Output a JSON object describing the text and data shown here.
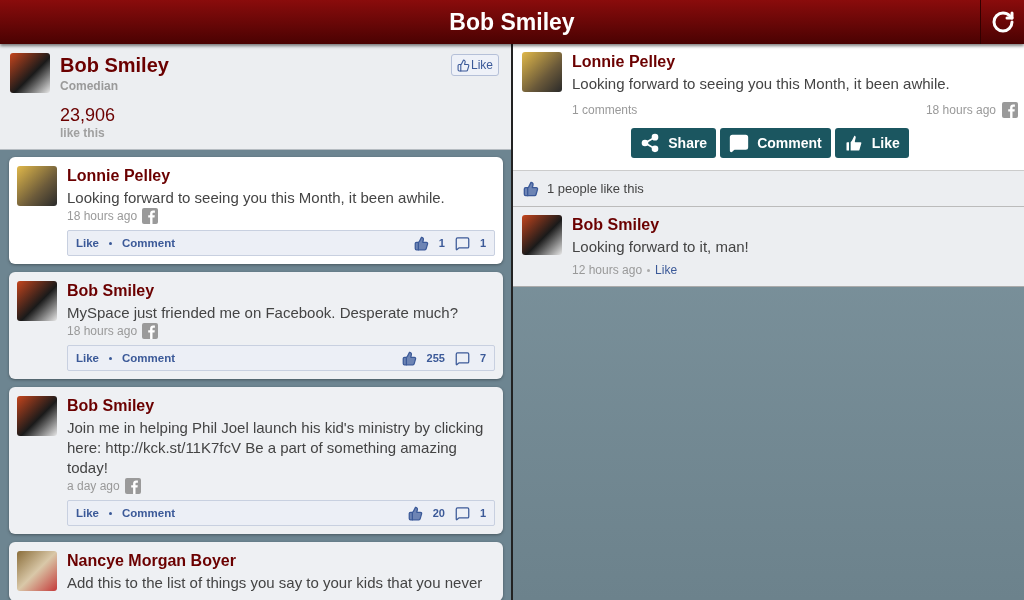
{
  "app_bar": {
    "title": "Bob Smiley"
  },
  "page": {
    "name": "Bob Smiley",
    "category": "Comedian",
    "like_button": "Like",
    "likes_count": "23,906",
    "likes_label": "like this"
  },
  "feed": [
    {
      "author": "Lonnie Pelley",
      "text": "Looking forward to seeing you this Month, it been awhile.",
      "time": "18 hours ago",
      "like_label": "Like",
      "comment_label": "Comment",
      "likes": "1",
      "comments": "1",
      "selected": true
    },
    {
      "author": "Bob Smiley",
      "text": "MySpace just friended me on Facebook. Desperate much?",
      "time": "18 hours ago",
      "like_label": "Like",
      "comment_label": "Comment",
      "likes": "255",
      "comments": "7",
      "selected": false
    },
    {
      "author": "Bob Smiley",
      "text": "Join me in helping Phil Joel launch his kid's ministry by clicking here: http://kck.st/11K7fcV Be a part of something amazing today!",
      "time": "a day ago",
      "like_label": "Like",
      "comment_label": "Comment",
      "likes": "20",
      "comments": "1",
      "selected": false
    },
    {
      "author": "Nancye Morgan Boyer",
      "text": "Add this to the list of things you say to your kids that you never",
      "selected": false
    }
  ],
  "detail": {
    "author": "Lonnie Pelley",
    "text": "Looking forward to seeing you this Month, it been awhile.",
    "comments_count": "1 comments",
    "time": "18 hours ago",
    "actions": [
      {
        "kind": "share",
        "label": "Share"
      },
      {
        "kind": "comment",
        "label": "Comment"
      },
      {
        "kind": "like",
        "label": "Like"
      }
    ],
    "likes_summary": "1 people like this",
    "replies": [
      {
        "author": "Bob Smiley",
        "text": "Looking forward to it, man!",
        "time": "12 hours ago",
        "like_label": "Like"
      }
    ]
  }
}
